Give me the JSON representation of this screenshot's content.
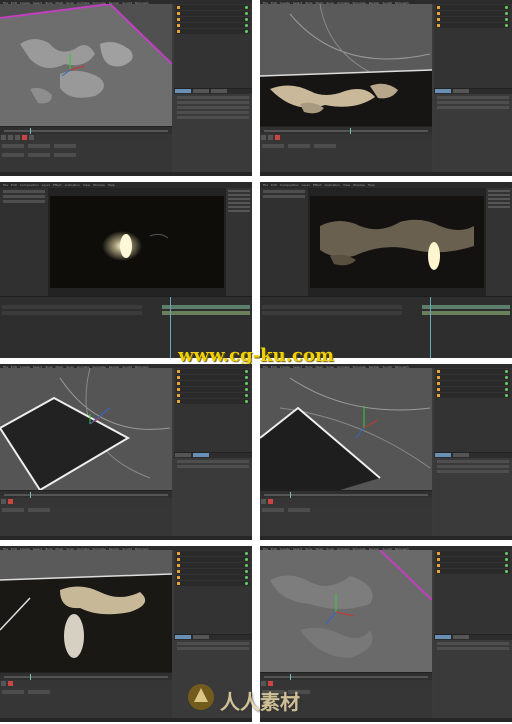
{
  "c4d_menu": [
    "File",
    "Edit",
    "Create",
    "Select",
    "Tools",
    "Mesh",
    "Snap",
    "Animate",
    "Simulate",
    "Render",
    "Sculpt",
    "MoGraph",
    "Character",
    "Pipeline",
    "Plugins",
    "Script",
    "Window",
    "Help"
  ],
  "ae_menu": [
    "File",
    "Edit",
    "Composition",
    "Layer",
    "Effect",
    "Animation",
    "View",
    "Window",
    "Help"
  ],
  "watermark_text": "www.cg-ku.com",
  "logo_text": "人人素材",
  "colors": {
    "c4d_bg": "#3b3b3b",
    "viewport_bg": "#4a4a4a",
    "accent_blue": "#6a8fb5",
    "record_red": "#cc4444",
    "watermark_yellow": "#f0d000",
    "boundary_magenta": "#c040c0"
  }
}
